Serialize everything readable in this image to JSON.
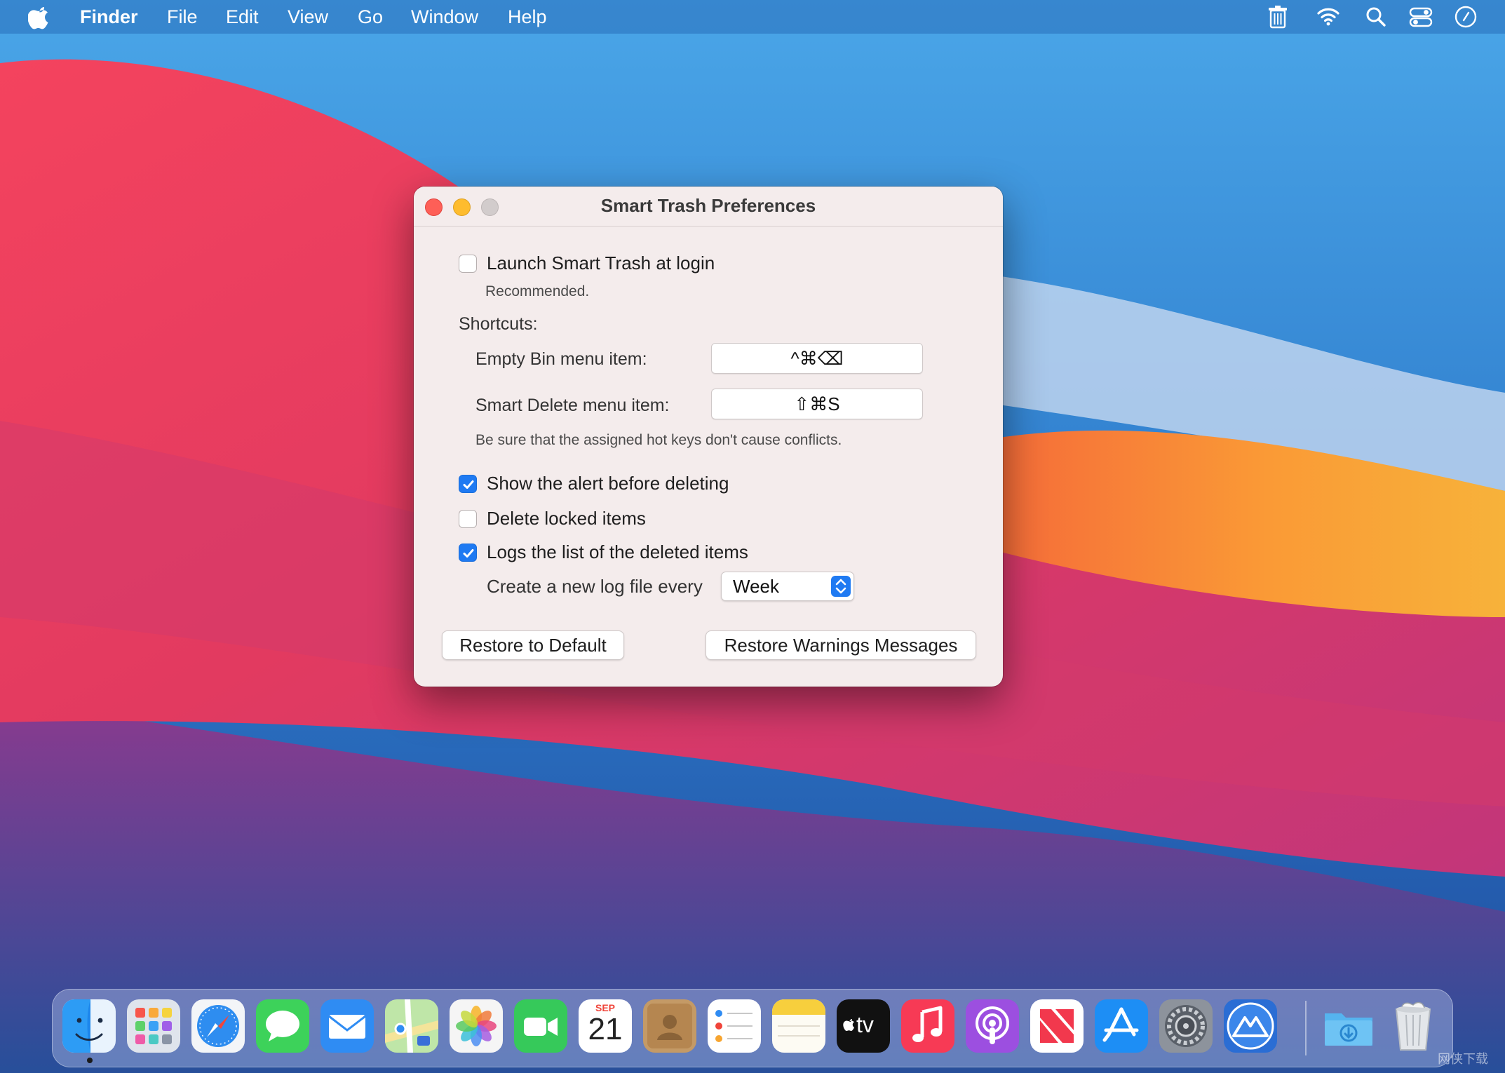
{
  "menubar": {
    "app_name": "Finder",
    "items": [
      "File",
      "Edit",
      "View",
      "Go",
      "Window",
      "Help"
    ]
  },
  "window": {
    "title": "Smart Trash Preferences",
    "launch_at_login": {
      "label": "Launch Smart Trash at login",
      "checked": false,
      "note": "Recommended."
    },
    "shortcuts": {
      "heading": "Shortcuts:",
      "empty_bin_label": "Empty Bin menu item:",
      "empty_bin_keys": "^⌘⌫",
      "smart_delete_label": "Smart Delete menu item:",
      "smart_delete_keys": "⇧⌘S",
      "hint": "Be sure that the assigned hot keys don't cause conflicts."
    },
    "options": {
      "show_alert": {
        "label": "Show the alert before deleting",
        "checked": true
      },
      "delete_locked": {
        "label": "Delete locked items",
        "checked": false
      },
      "logs": {
        "label": "Logs the list of the deleted items",
        "checked": true
      }
    },
    "log_frequency": {
      "label": "Create a new log file every",
      "value": "Week"
    },
    "buttons": {
      "restore_default": "Restore to Default",
      "restore_warnings": "Restore Warnings Messages"
    }
  },
  "dock": {
    "calendar_month": "SEP",
    "calendar_day": "21",
    "tv_label": "tv",
    "apps": [
      "finder",
      "launchpad",
      "safari",
      "messages",
      "mail",
      "maps",
      "photos",
      "facetime",
      "calendar",
      "contacts",
      "reminders",
      "notes",
      "apple-tv",
      "music",
      "podcasts",
      "news",
      "app-store",
      "system-preferences",
      "migration-assistant",
      "downloads",
      "trash"
    ]
  },
  "colors": {
    "accent": "#1f7af2",
    "close": "#fe5f57",
    "minimize": "#febc2e"
  },
  "watermark": "网侠下载"
}
